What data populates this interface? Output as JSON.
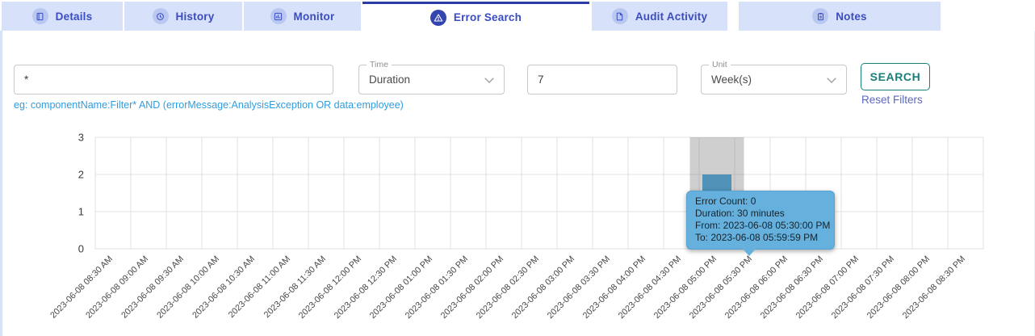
{
  "tabs": [
    {
      "label": "Details",
      "icon": "book-icon",
      "active": false
    },
    {
      "label": "History",
      "icon": "history-icon",
      "active": false
    },
    {
      "label": "Monitor",
      "icon": "bar-chart-icon",
      "active": false
    },
    {
      "label": "Error Search",
      "icon": "warning-icon",
      "active": true
    },
    {
      "label": "Audit Activity",
      "icon": "document-icon",
      "active": false
    },
    {
      "label": "Notes",
      "icon": "notes-icon",
      "active": false
    }
  ],
  "filters": {
    "query": {
      "value": "*",
      "hint": "eg: componentName:Filter* AND (errorMessage:AnalysisException OR data:employee)"
    },
    "time": {
      "label": "Time",
      "value": "Duration"
    },
    "duration_count": {
      "value": "7"
    },
    "unit": {
      "label": "Unit",
      "value": "Week(s)"
    },
    "search_label": "SEARCH",
    "reset_label": "Reset Filters"
  },
  "tooltip": {
    "lines": [
      "Error Count: 0",
      "Duration: 30 minutes",
      "From: 2023-06-08 05:30:00 PM",
      "To: 2023-06-08 05:59:59 PM"
    ]
  },
  "chart_data": {
    "type": "bar",
    "title": "",
    "xlabel": "",
    "ylabel": "",
    "ylim": [
      0,
      3
    ],
    "yticks": [
      0,
      1,
      2,
      3
    ],
    "grid": true,
    "categories": [
      "2023-06-08 08:30 AM",
      "2023-06-08 09:00 AM",
      "2023-06-08 09:30 AM",
      "2023-06-08 10:00 AM",
      "2023-06-08 10:30 AM",
      "2023-06-08 11:00 AM",
      "2023-06-08 11:30 AM",
      "2023-06-08 12:00 PM",
      "2023-06-08 12:30 PM",
      "2023-06-08 01:00 PM",
      "2023-06-08 01:30 PM",
      "2023-06-08 02:00 PM",
      "2023-06-08 02:30 PM",
      "2023-06-08 03:00 PM",
      "2023-06-08 03:30 PM",
      "2023-06-08 04:00 PM",
      "2023-06-08 04:30 PM",
      "2023-06-08 05:00 PM",
      "2023-06-08 05:30 PM",
      "2023-06-08 06:00 PM",
      "2023-06-08 06:30 PM",
      "2023-06-08 07:00 PM",
      "2023-06-08 07:30 PM",
      "2023-06-08 08:00 PM",
      "2023-06-08 08:30 PM"
    ],
    "values": [
      0,
      0,
      0,
      0,
      0,
      0,
      0,
      0,
      0,
      0,
      0,
      0,
      0,
      0,
      0,
      0,
      0,
      0,
      2,
      0,
      0,
      0,
      0,
      0,
      0
    ],
    "highlighted_category": "2023-06-08 05:30 PM",
    "bar_color": "#5092b8",
    "highlight_band_color": "rgba(110,110,110,0.33)",
    "grid_color": "#e2e2e2",
    "legend": "none"
  },
  "colors": {
    "accent_indigo": "#3b4cc0",
    "tab_bg": "#d7e1fa",
    "active_tab_border": "#2c3ca6",
    "teal": "#187f78",
    "link_indigo": "#5b68c0",
    "hint_blue": "#2f9ce0",
    "tooltip_bg": "#65b0dc"
  }
}
